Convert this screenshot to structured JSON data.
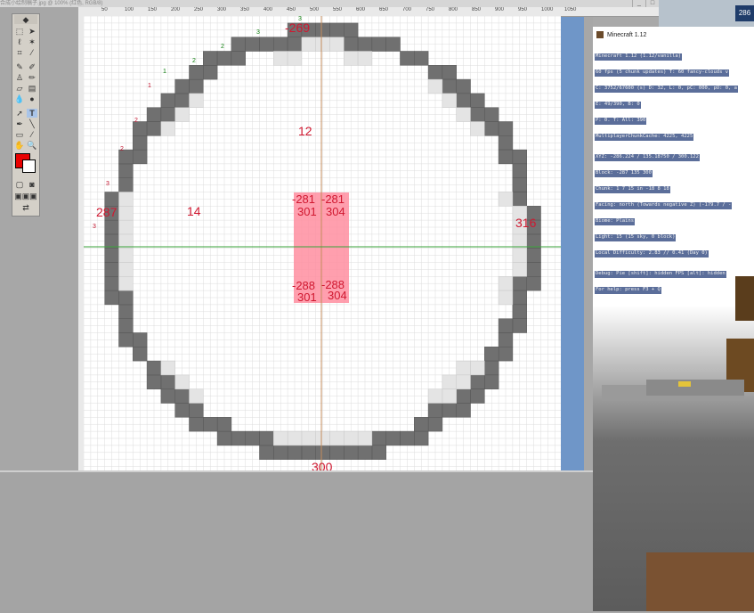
{
  "photoshop": {
    "title": "合成小绘制稿子.jpg @ 100% (红色, RGB/8)",
    "window_buttons": [
      "_",
      "□"
    ],
    "ruler_marks": [
      "50",
      "100",
      "150",
      "200",
      "250",
      "300",
      "350",
      "400",
      "450",
      "500",
      "550",
      "600",
      "650",
      "700",
      "750",
      "800",
      "850",
      "900",
      "950",
      "1000",
      "1050"
    ],
    "colors": {
      "canvas": "#ffffff",
      "grid": "#dcdcdc",
      "block_dark": "#707070",
      "block_light": "#e4e4e4",
      "highlight": "#ff8ea0",
      "guide_v": "#c48c5c",
      "guide_h": "#3aa33a",
      "label": "#d01830",
      "doc_frame": "#6f96c8"
    }
  },
  "toolbox": {
    "tools": [
      "move-tool",
      "marquee-tool",
      "lasso-tool",
      "magic-wand-tool",
      "crop-tool",
      "slice-tool",
      "healing-brush-tool",
      "brush-tool",
      "clone-stamp-tool",
      "history-brush-tool",
      "eraser-tool",
      "gradient-tool",
      "blur-tool",
      "dodge-tool",
      "path-selection-tool",
      "type-tool",
      "pen-tool",
      "shape-tool",
      "notes-tool",
      "eyedropper-tool",
      "hand-tool",
      "zoom-tool"
    ],
    "foreground_color": "#e80000",
    "background_color": "#ffffff"
  },
  "canvas_labels": {
    "top": "-269",
    "bottom": "300",
    "left": "287",
    "right": "316",
    "center_radius": "12",
    "left_radius": "14",
    "box": {
      "tl": "-281",
      "tr": "-281",
      "ml_top": "301",
      "mr_top": "304",
      "bl": "-288",
      "br": "-288",
      "ml_bot": "301",
      "mr_bot": "304"
    },
    "small_marks": {
      "n3": "3",
      "n2": "2",
      "n2b": "2",
      "n1": "1",
      "n1b": "1",
      "r2": "2",
      "r2b": "2",
      "r2c": "2",
      "r3": "3",
      "r3b": "3"
    }
  },
  "minecraft": {
    "window_title": "Minecraft 1.12",
    "badge": "286",
    "debug_lines": [
      "Minecraft 1.12 (1.12/vanilla)",
      "60 fps (5 chunk updates) T: 60 fancy-clouds v",
      "C: 3752/67600 (s) D: 32, L: 0, pC: 000, pU: 0, a",
      "E: 49/390, B: 0",
      "P: 0. T: All: 390",
      "MultiplayerChunkCache: 4225, 4225",
      "",
      "XYZ: -286.224 / 135.18750 / 300.122",
      "Block: -287 135 300",
      "Chunk: 1 7 15 in -18 8 18",
      "Facing: north (Towards negative Z) (-179.7 / -",
      "Biome: Plains",
      "Light: 15 (15 sky, 0 block)",
      "Local Difficulty: 2.83 // 0.41 (Day 0)",
      "",
      "Debug: Pie [shift]: hidden FPS [alt]: hidden",
      "For help: press F3 + Q"
    ]
  }
}
